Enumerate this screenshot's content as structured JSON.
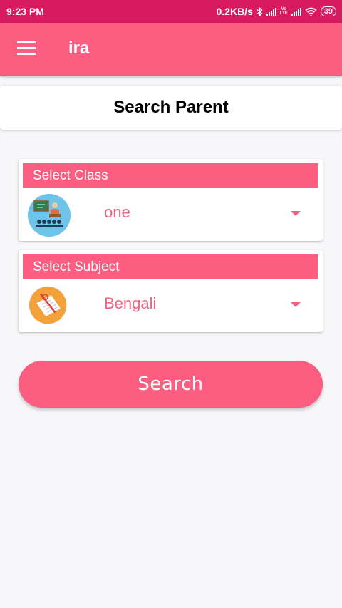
{
  "status_bar": {
    "time": "9:23 PM",
    "network_speed": "0.2KB/s",
    "volte_top": "Vo",
    "volte_bottom": "LTE",
    "battery": "39",
    "icons": [
      "bluetooth-icon",
      "signal-icon",
      "volte-icon",
      "wifi-icon",
      "battery-icon"
    ]
  },
  "app_bar": {
    "title": "ira",
    "menu_icon": "hamburger-menu-icon"
  },
  "page": {
    "title": "Search Parent"
  },
  "class_select": {
    "label": "Select Class",
    "value": "one",
    "icon": "classroom-teacher-icon"
  },
  "subject_select": {
    "label": "Select Subject",
    "value": "Bengali",
    "icon": "exam-paper-icon"
  },
  "search_button": {
    "label": "Search"
  },
  "colors": {
    "status_bar": "#d81b60",
    "accent": "#fd5d80",
    "value_text": "#f0627f",
    "background": "#f7f7f9"
  }
}
